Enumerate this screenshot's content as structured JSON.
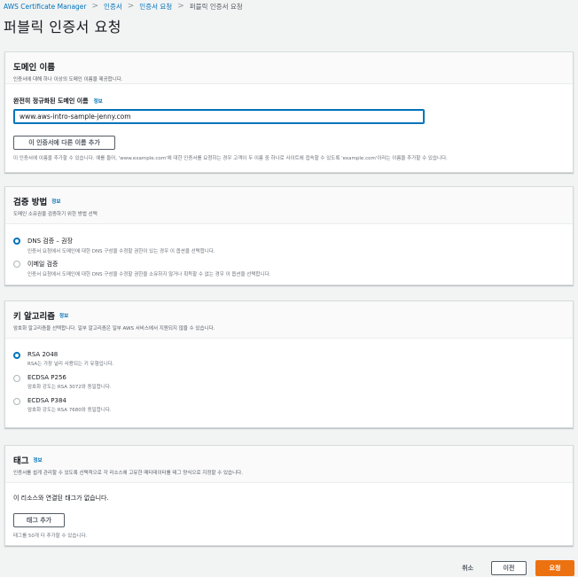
{
  "breadcrumb": {
    "items": [
      "AWS Certificate Manager",
      "인증서",
      "인증서 요청"
    ],
    "current": "퍼블릭 인증서 요청",
    "separator": ">"
  },
  "page_title": "퍼블릭 인증서 요청",
  "domain_section": {
    "title": "도메인 이름",
    "description": "인증서에 대해 하나 이상의 도메인 이름을 제공합니다.",
    "field_label": "완전히 정규화된 도메인 이름",
    "info": "정보",
    "domain_value": "www.aws-intro-sample-jenny.com",
    "add_button": "이 인증서에 다른 이름 추가",
    "hint": "이 인증서에 이름을 추가할 수 있습니다. 예를 들어, 'www.example.com'에 대한 인증서를 요청하는 경우 고객이 두 이름 중 하나로 사이트에 접속할 수 있도록 'example.com'이라는 이름을 추가할 수 있습니다."
  },
  "validation_section": {
    "title": "검증 방법",
    "info": "정보",
    "description": "도메인 소유권을 검증하기 위한 방법 선택",
    "options": [
      {
        "label": "DNS 검증 – 권장",
        "desc": "인증서 요청에서 도메인에 대한 DNS 구성을 수정할 권한이 있는 경우 이 옵션을 선택합니다.",
        "checked": true
      },
      {
        "label": "이메일 검증",
        "desc": "인증서 요청에서 도메인에 대한 DNS 구성을 수정할 권한을 소유하지 않거나 획득할 수 없는 경우 이 옵션을 선택합니다.",
        "checked": false
      }
    ]
  },
  "key_section": {
    "title": "키 알고리즘",
    "info": "정보",
    "description": "암호화 알고리즘을 선택합니다. 일부 알고리즘은 일부 AWS 서비스에서 지원되지 않을 수 있습니다.",
    "options": [
      {
        "label": "RSA 2048",
        "desc": "RSA는 가장 널리 사용되는 키 유형입니다.",
        "checked": true
      },
      {
        "label": "ECDSA P256",
        "desc": "암호화 강도는 RSA 3072와 동일합니다.",
        "checked": false
      },
      {
        "label": "ECDSA P384",
        "desc": "암호화 강도는 RSA 7680와 동일합니다.",
        "checked": false
      }
    ]
  },
  "tags_section": {
    "title": "태그",
    "info": "정보",
    "description": "인증서를 쉽게 관리할 수 있도록 선택적으로 각 리소스에 고유한 메타데이터를 태그 양식으로 지정할 수 있습니다.",
    "empty_text": "이 리소스와 연결된 태그가 없습니다.",
    "add_button": "태그 추가",
    "hint": "태그를 50개 더 추가할 수 있습니다."
  },
  "footer": {
    "cancel": "취소",
    "previous": "이전",
    "submit": "요청"
  },
  "colors": {
    "primary": "#ec7211",
    "link": "#0073bb",
    "background": "#f2f3f3"
  }
}
